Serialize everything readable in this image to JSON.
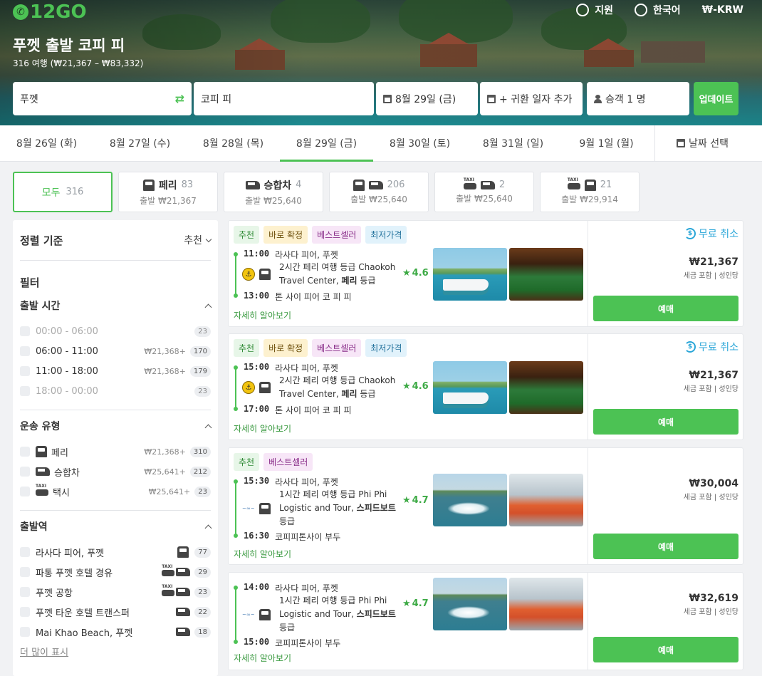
{
  "header": {
    "logo": "12GO",
    "support": "지원",
    "language": "한국어",
    "currency": "₩-KRW",
    "title": "푸껫 출발 코피 피",
    "subtitle": "316 여행 (₩21,367 – ₩83,332)"
  },
  "search": {
    "from": "푸껫",
    "to": "코피 피",
    "date": "8월 29일 (금)",
    "return": "+ 귀환 일자 추가",
    "passengers": "승객 1 명",
    "update_label": "업데이트"
  },
  "dates": [
    "8월 26일 (화)",
    "8월 27일 (수)",
    "8월 28일 (목)",
    "8월 29일 (금)",
    "8월 30일 (토)",
    "8월 31일 (일)",
    "9월 1일 (월)"
  ],
  "date_pick": "날짜 선택",
  "tabs": {
    "all": {
      "label": "모두",
      "count": "316"
    },
    "items": [
      {
        "label": "페리",
        "count": "83",
        "from": "출발 ₩21,367"
      },
      {
        "label": "승합차",
        "count": "4",
        "from": "출발 ₩25,640"
      },
      {
        "label": "",
        "count": "206",
        "from": "출발 ₩25,640"
      },
      {
        "label": "",
        "count": "2",
        "from": "출발 ₩25,640"
      },
      {
        "label": "",
        "count": "21",
        "from": "출발 ₩29,914"
      }
    ]
  },
  "sidebar": {
    "sort_label": "정렬 기준",
    "sort_value": "추천",
    "filter_title": "필터",
    "departure_time": {
      "title": "출발 시간",
      "options": [
        {
          "label": "00:00 - 06:00",
          "price": "",
          "count": "23"
        },
        {
          "label": "06:00 - 11:00",
          "price": "₩21,368+",
          "count": "170"
        },
        {
          "label": "11:00 - 18:00",
          "price": "₩21,368+",
          "count": "179"
        },
        {
          "label": "18:00 - 00:00",
          "price": "",
          "count": "23"
        }
      ]
    },
    "transport": {
      "title": "운송 유형",
      "options": [
        {
          "label": "페리",
          "price": "₩21,368+",
          "count": "310"
        },
        {
          "label": "승합차",
          "price": "₩25,641+",
          "count": "212"
        },
        {
          "label": "택시",
          "price": "₩25,641+",
          "count": "23"
        }
      ]
    },
    "station": {
      "title": "출발역",
      "options": [
        {
          "label": "라사다 피어, 푸껫",
          "count": "77"
        },
        {
          "label": "파통 푸껫 호텔 경유",
          "count": "29"
        },
        {
          "label": "푸껫 공항",
          "count": "23"
        },
        {
          "label": "푸껫 타운 호텔 트랜스퍼",
          "count": "22"
        },
        {
          "label": "Mai Khao Beach, 푸껫",
          "count": "18"
        }
      ],
      "more": "더 많이 표시"
    }
  },
  "results": [
    {
      "tags": [
        "추천",
        "바로 확정",
        "베스트셀러",
        "최저가격"
      ],
      "dep_time": "11:00",
      "dep_place": "라사다 피어, 푸껫",
      "desc_a": "2시간 페리 여행 등급 Chaokoh Travel Center, ",
      "desc_b": "페리",
      "desc_c": " 등급",
      "arr_time": "13:00",
      "arr_place": "톤 사이 피어 코 피 피",
      "rating": "4.6",
      "more": "자세히 알아보기",
      "cancel": "무료 취소",
      "price": "₩21,367",
      "tax": "세금 포함 | 성인당",
      "book": "예매"
    },
    {
      "tags": [
        "추천",
        "바로 확정",
        "베스트셀러",
        "최저가격"
      ],
      "dep_time": "15:00",
      "dep_place": "라사다 피어, 푸껫",
      "desc_a": "2시간 페리 여행 등급 Chaokoh Travel Center, ",
      "desc_b": "페리",
      "desc_c": " 등급",
      "arr_time": "17:00",
      "arr_place": "톤 사이 피어 코 피 피",
      "rating": "4.6",
      "more": "자세히 알아보기",
      "cancel": "무료 취소",
      "price": "₩21,367",
      "tax": "세금 포함 | 성인당",
      "book": "예매"
    },
    {
      "tags": [
        "추천",
        "베스트셀러"
      ],
      "dep_time": "15:30",
      "dep_place": "라사다 피어, 푸껫",
      "desc_a": "1시간 페리 여행 등급 Phi Phi Logistic and Tour, ",
      "desc_b": "스피드보트",
      "desc_c": " 등급",
      "arr_time": "16:30",
      "arr_place": "코피피톤사이 부두",
      "rating": "4.7",
      "more": "자세히 알아보기",
      "cancel": "",
      "price": "₩30,004",
      "tax": "세금 포함 | 성인당",
      "book": "예매"
    },
    {
      "tags": [],
      "dep_time": "14:00",
      "dep_place": "라사다 피어, 푸껫",
      "desc_a": "1시간 페리 여행 등급 Phi Phi Logistic and Tour, ",
      "desc_b": "스피드보트",
      "desc_c": " 등급",
      "arr_time": "15:00",
      "arr_place": "코피피톤사이 부두",
      "rating": "4.7",
      "more": "자세히 알아보기",
      "cancel": "",
      "price": "₩32,619",
      "tax": "세금 포함 | 성인당",
      "book": "예매"
    }
  ],
  "colors": {
    "accent": "#4cc254",
    "cancel": "#2aa6d8"
  }
}
